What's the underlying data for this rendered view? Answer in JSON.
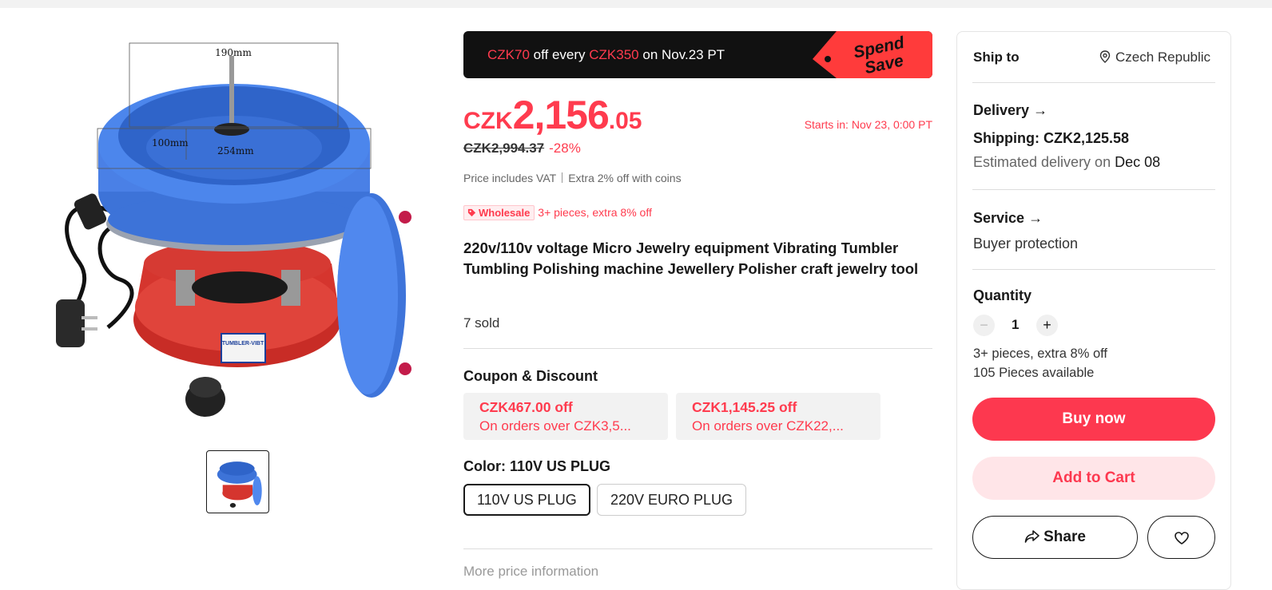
{
  "banner": {
    "amount": "CZK70",
    "text1": " off every ",
    "threshold": "CZK350",
    "text2": " on Nov.23 PT",
    "tag_line1": "Spend",
    "tag_line2": "Save"
  },
  "gallery": {
    "dim_top": "190mm",
    "dim_left": "100mm",
    "dim_diameter": "254mm",
    "label": "TUMBLER-VIBT"
  },
  "price": {
    "currency": "CZK",
    "integer": "2,156",
    "decimal": ".05",
    "starts": "Starts in: Nov 23, 0:00 PT",
    "original": "CZK2,994.37",
    "discount": "-28%",
    "vat": "Price includes VAT",
    "coins": "Extra 2% off with coins"
  },
  "wholesale": {
    "badge": "Wholesale",
    "text": "3+ pieces, extra 8% off"
  },
  "product": {
    "title": "220v/110v voltage Micro Jewelry equipment Vibrating Tumbler Tumbling Polishing machine Jewellery Polisher craft jewelry tool",
    "sold": "7 sold"
  },
  "coupons": {
    "heading": "Coupon & Discount",
    "items": [
      {
        "off": "CZK467.00 off",
        "cond": "On orders over CZK3,5..."
      },
      {
        "off": "CZK1,145.25 off",
        "cond": "On orders over CZK22,..."
      }
    ]
  },
  "color": {
    "heading": "Color: 110V US PLUG",
    "options": [
      "110V US PLUG",
      "220V EURO PLUG"
    ],
    "selected": "110V US PLUG"
  },
  "more_info": "More price information",
  "side": {
    "ship_to_label": "Ship to",
    "country": "Czech Republic",
    "delivery_label": "Delivery",
    "shipping": "Shipping: CZK2,125.58",
    "est_prefix": "Estimated delivery on ",
    "est_date": "Dec 08",
    "service_label": "Service",
    "service_value": "Buyer protection",
    "quantity_label": "Quantity",
    "quantity": "1",
    "qty_note": "3+ pieces, extra 8% off",
    "available": "105 Pieces available",
    "buy_now": "Buy now",
    "add_to_cart": "Add to Cart",
    "share": "Share"
  },
  "colors": {
    "accent": "#fd384f",
    "banner_bg": "#111111",
    "cart_bg": "#ffe5e8"
  }
}
